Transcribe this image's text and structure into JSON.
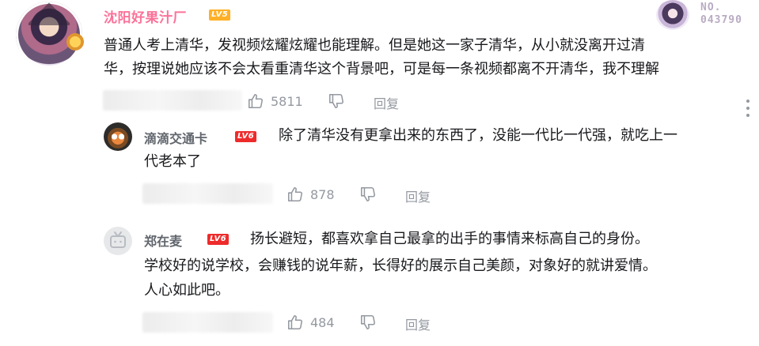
{
  "main_comment": {
    "username": "沈阳好果汁厂",
    "level_badge": "LV5",
    "decoration": {
      "label": "NO.",
      "number": "043790"
    },
    "text_line1": "普通人考上清华，发视频炫耀炫耀也能理解。但是她这一家子清华，从小就没离开过清",
    "text_line2": "华，按理说她应该不会太看重清华这个背景吧，可是每一条视频都离不开清华，我不理解",
    "likes": "5811",
    "reply_label": "回复",
    "more_icon": "more-vertical-icon"
  },
  "replies": [
    {
      "username": "滴滴交通卡",
      "level_badge": "LV6",
      "text_line1": "除了清华没有更拿出来的东西了，没能一代比一代强，就吃上一",
      "text_line2": "代老本了",
      "likes": "878",
      "reply_label": "回复"
    },
    {
      "username": "郑在麦",
      "level_badge": "LV6",
      "text_line1": "扬长避短，都喜欢拿自己最拿的出手的事情来标高自己的身份。",
      "text_line2": "学校好的说学校，会赚钱的说年薪，长得好的展示自己美颜，对象好的就讲爱情。",
      "text_line3": "人心如此吧。",
      "likes": "484",
      "reply_label": "回复"
    }
  ],
  "colors": {
    "username_vip": "#fb7299",
    "username": "#61666d",
    "text": "#18191c",
    "muted": "#9499a0",
    "lv5": "#ffb027",
    "lv6": "#ee2b2b"
  }
}
